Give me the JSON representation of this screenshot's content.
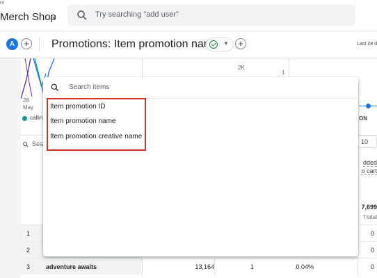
{
  "header": {
    "account_caption": "nt",
    "property_name": "Merch Shop",
    "search_placeholder": "Try searching \"add user\""
  },
  "report_header": {
    "avatar_letter": "A",
    "title": "Promotions: Item promotion name",
    "date_range": "Last 28 d"
  },
  "chart": {
    "y_tick_2k": "2K",
    "y_tick_1": "1",
    "x_tick_day": "28",
    "x_tick_month": "May",
    "legend_label": "callin",
    "right_label": "ON"
  },
  "table": {
    "search_text": "Sear",
    "rows_per_page": "10",
    "column_header_line1": "dded",
    "column_header_line2": "o cart",
    "total_value": "7,699",
    "total_sub": "f total",
    "rows": [
      {
        "index": "1",
        "name": "",
        "c1": "",
        "c2": "",
        "c3": "",
        "c4": "0"
      },
      {
        "index": "2",
        "name": "",
        "c1": "",
        "c2": "",
        "c3": "",
        "c4": "0"
      },
      {
        "index": "3",
        "name": "adventure awaits",
        "c1": "13,164",
        "c2": "1",
        "c3": "0.04%",
        "c4": "0"
      }
    ]
  },
  "dropdown": {
    "search_placeholder": "Search items",
    "options": [
      "Item promotion ID",
      "Item promotion name",
      "Item promotion creative name"
    ]
  },
  "colors": {
    "accent_blue": "#1a73e8",
    "highlight_red": "#d93025",
    "success_green": "#188038"
  }
}
